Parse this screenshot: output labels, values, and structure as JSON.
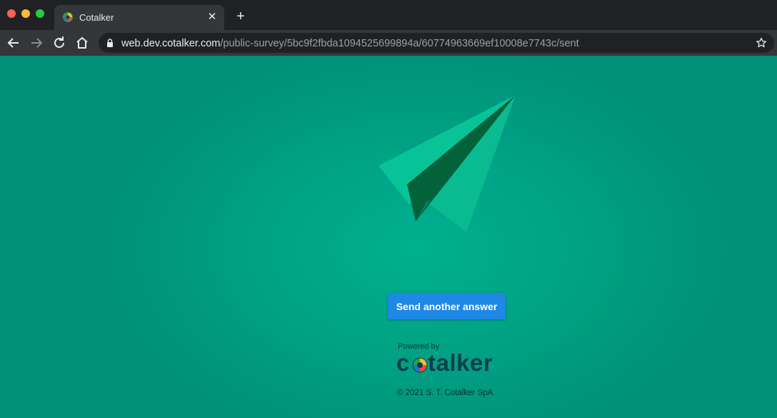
{
  "browser": {
    "tab_title": "Cotalker",
    "url_host": "web.dev.cotalker.com",
    "url_path": "/public-survey/5bc9f2fbda1094525699894a/60774963669ef10008e7743c/sent"
  },
  "page": {
    "send_button_label": "Send another answer",
    "powered_by": "Powered by",
    "logo_text_start": "c",
    "logo_text_end": "talker",
    "copyright": "© 2021 S. T. Cotalker SpA"
  },
  "colors": {
    "page_bg": "#00a386",
    "button": "#1e88e5",
    "logo_text": "#0f3c4c"
  }
}
